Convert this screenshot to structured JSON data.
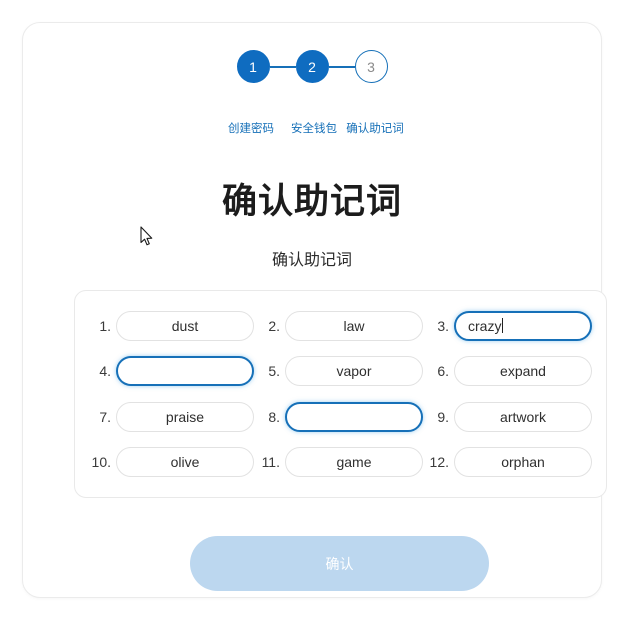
{
  "stepper": {
    "steps": [
      {
        "number": "1",
        "label": "创建密码",
        "state": "done"
      },
      {
        "number": "2",
        "label": "安全钱包",
        "state": "done"
      },
      {
        "number": "3",
        "label": "确认助记词",
        "state": "todo"
      }
    ]
  },
  "heading": {
    "title": "确认助记词",
    "subtitle": "确认助记词"
  },
  "words": [
    {
      "index": "1.",
      "value": "dust",
      "focused": false
    },
    {
      "index": "2.",
      "value": "law",
      "focused": false
    },
    {
      "index": "3.",
      "value": "crazy",
      "focused": true
    },
    {
      "index": "4.",
      "value": "",
      "focused": true
    },
    {
      "index": "5.",
      "value": "vapor",
      "focused": false
    },
    {
      "index": "6.",
      "value": "expand",
      "focused": false
    },
    {
      "index": "7.",
      "value": "praise",
      "focused": false
    },
    {
      "index": "8.",
      "value": "",
      "focused": true
    },
    {
      "index": "9.",
      "value": "artwork",
      "focused": false
    },
    {
      "index": "10.",
      "value": "olive",
      "focused": false
    },
    {
      "index": "11.",
      "value": "game",
      "focused": false
    },
    {
      "index": "12.",
      "value": "orphan",
      "focused": false
    }
  ],
  "confirm_button": {
    "label": "确认"
  },
  "colors": {
    "accent_blue": "#0f6cc0",
    "step_border_blue": "#1670b8",
    "focus_blue": "#1670b8",
    "button_disabled": "#bcd7ef",
    "card_border": "#ebebeb",
    "input_border": "#e2e2e2"
  },
  "cursor": {
    "icon": "mouse-pointer"
  }
}
